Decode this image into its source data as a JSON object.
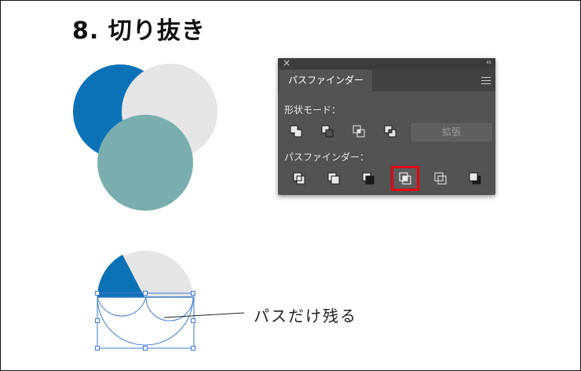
{
  "title": "8. 切り抜き",
  "colors": {
    "blue": "#0c72b6",
    "gray": "#e5e5e5",
    "teal": "#7aaeae",
    "selection": "#3f7bd1",
    "highlight": "#e60012",
    "panel_bg": "#535353"
  },
  "panel": {
    "close_icon": "×",
    "collapse_icon": "‹‹",
    "tab_label": "パスファインダー",
    "menu_icon": "hamburger-icon",
    "shape_modes_label": "形状モード：",
    "shape_mode_tools": [
      "unite-icon",
      "minus-front-icon",
      "intersect-icon",
      "exclude-icon"
    ],
    "expand_label": "拡張",
    "pathfinders_label": "パスファインダー：",
    "pathfinder_tools": [
      "divide-icon",
      "trim-icon",
      "merge-icon",
      "crop-icon",
      "outline-icon",
      "minus-back-icon"
    ],
    "selected_tool": "crop-icon"
  },
  "caption": "パスだけ残る"
}
